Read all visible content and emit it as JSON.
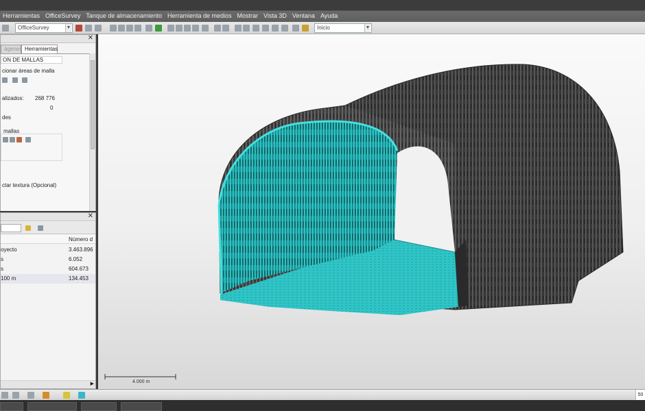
{
  "menu": {
    "items": [
      "Herramientas",
      "OfficeSurvey",
      "Tanque de almacenamiento",
      "Herramienta de medios",
      "Mostrar",
      "Vista 3D",
      "Ventana",
      "Ayuda"
    ]
  },
  "toolbar": {
    "profile_combo": "OfficeSurvey",
    "view_combo": "Inicio"
  },
  "tools_panel": {
    "tabs": [
      "ágenes",
      "Herramientas"
    ],
    "section_title": "ON DE MALLAS",
    "select_areas": "cionar áreas de malla",
    "normalized_label": "alizados:",
    "normalized_value": "268 776",
    "zero_value": "0",
    "des_label": "des",
    "mallas_label": "mallas",
    "texture_label": "ctar textura (Opcional)"
  },
  "grid_panel": {
    "column_header": "Número d",
    "rows": [
      {
        "name": "oyecto",
        "value": "3.463.896"
      },
      {
        "name": "s",
        "value": "6.052"
      },
      {
        "name": "s",
        "value": "604.673"
      },
      {
        "name": "100 m",
        "value": "134.453"
      }
    ]
  },
  "viewport": {
    "scale_label": "4.000 m"
  },
  "status": {
    "zoom": "50"
  },
  "colors": {
    "mesh_dark": "#3d3d3d",
    "mesh_cyan": "#2ec6c6"
  }
}
